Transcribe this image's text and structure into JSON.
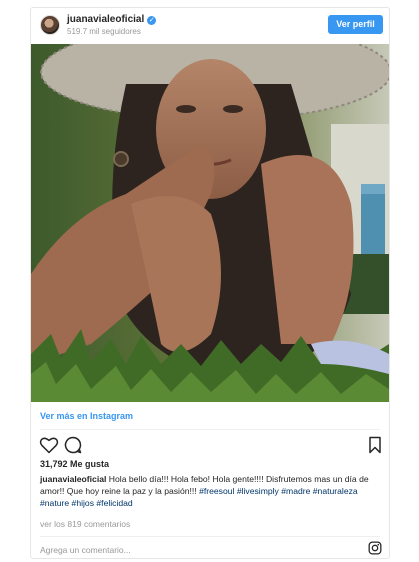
{
  "header": {
    "username": "juanavialeoficial",
    "followers": "519.7 mil seguidores",
    "view_profile_label": "Ver perfil"
  },
  "post": {
    "more_link": "Ver más en Instagram",
    "likes": "31,792 Me gusta",
    "caption": {
      "user": "juanavialeoficial",
      "text": " Hola bello día!!! Hola febo! Hola gente!!!! Disfrutemos mas un día de amor!! Que hoy reine la paz y la pasión!!! ",
      "tags": [
        "#freesoul",
        "#livesimply",
        "#madre",
        "#naturaleza",
        "#nature",
        "#hijos",
        "#felicidad"
      ]
    },
    "comments_link": "ver los 819 comentarios",
    "comment_placeholder": "Agrega un comentario..."
  },
  "icons": {
    "like": "heart-icon",
    "comment": "comment-icon",
    "save": "bookmark-icon",
    "instagram": "instagram-glyph-icon",
    "verified": "verified-badge-icon"
  },
  "colors": {
    "accent": "#3897f0",
    "hashtag": "#003569"
  }
}
